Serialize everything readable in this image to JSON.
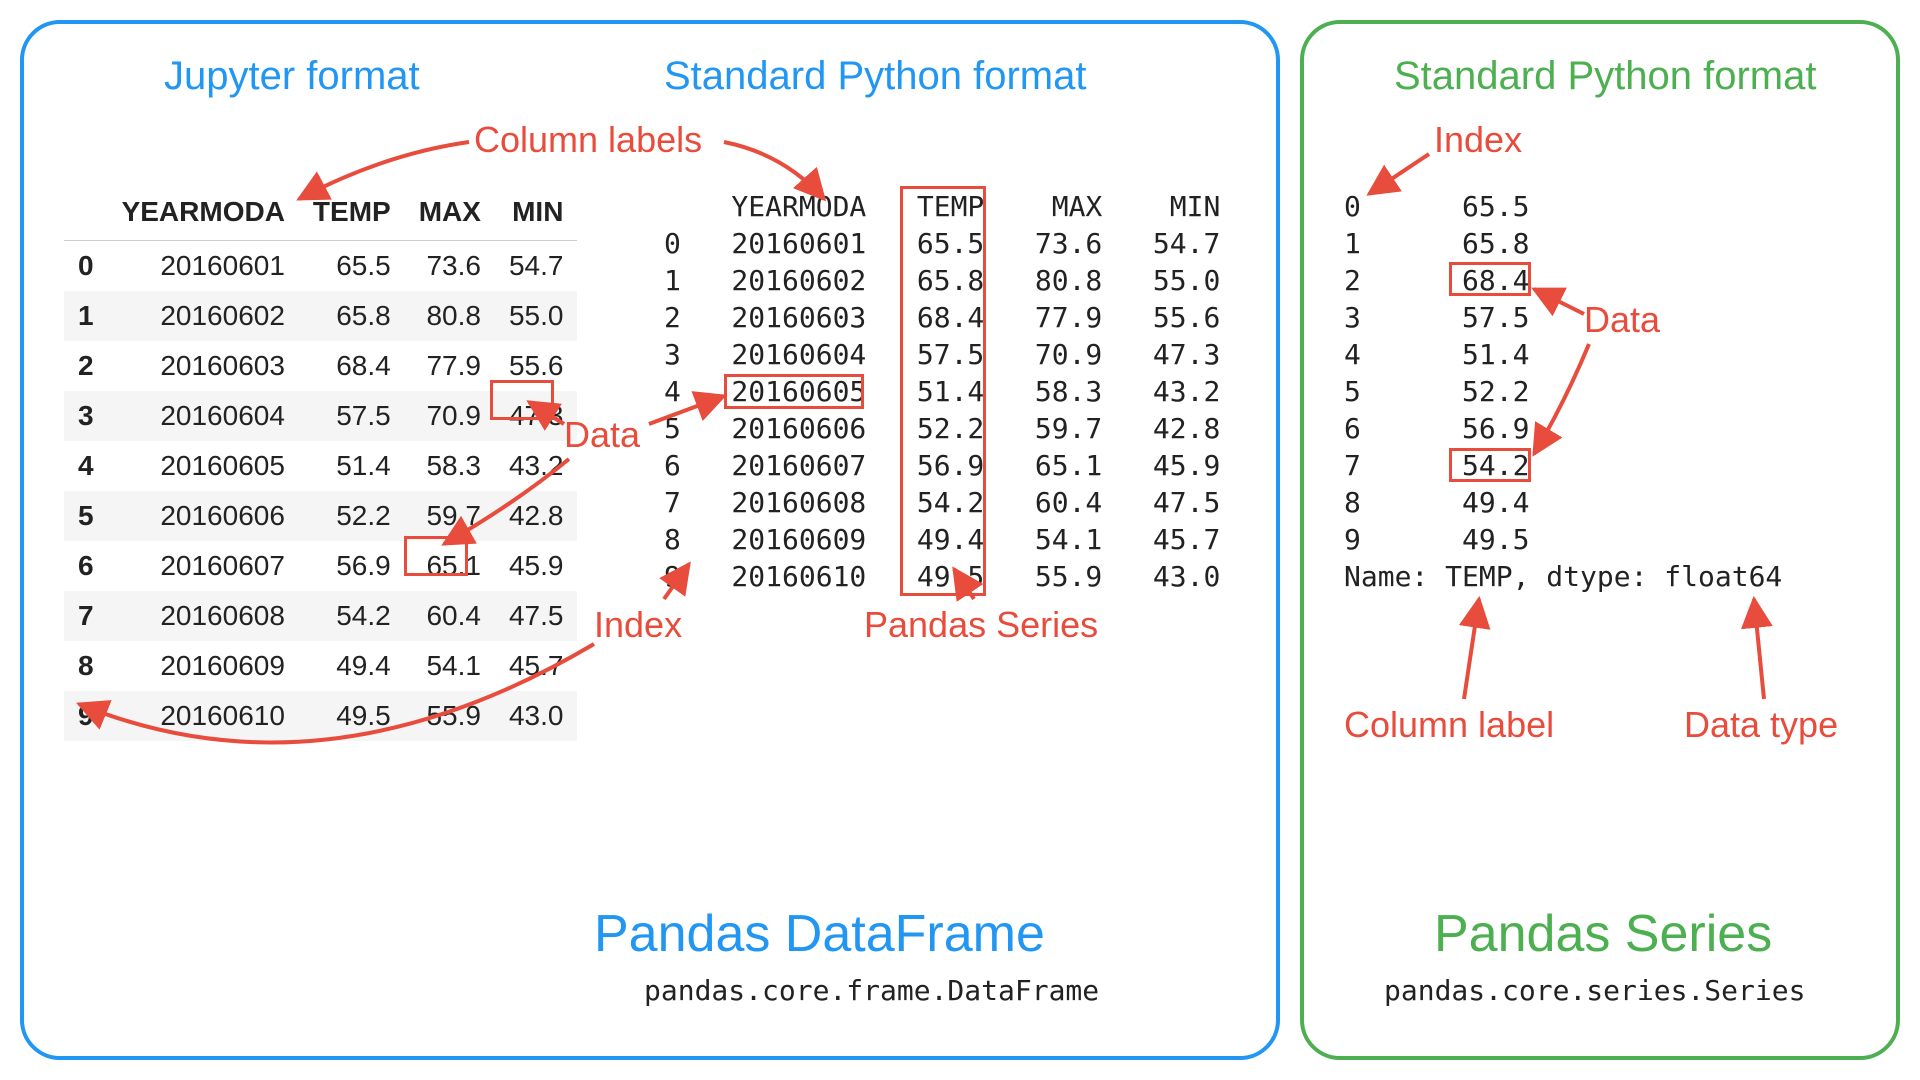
{
  "df_panel": {
    "jupyter_heading": "Jupyter format",
    "python_heading": "Standard Python format",
    "title": "Pandas DataFrame",
    "subtitle": "pandas.core.frame.DataFrame",
    "columns": [
      "YEARMODA",
      "TEMP",
      "MAX",
      "MIN"
    ],
    "rows": [
      {
        "idx": "0",
        "YEARMODA": "20160601",
        "TEMP": "65.5",
        "MAX": "73.6",
        "MIN": "54.7"
      },
      {
        "idx": "1",
        "YEARMODA": "20160602",
        "TEMP": "65.8",
        "MAX": "80.8",
        "MIN": "55.0"
      },
      {
        "idx": "2",
        "YEARMODA": "20160603",
        "TEMP": "68.4",
        "MAX": "77.9",
        "MIN": "55.6"
      },
      {
        "idx": "3",
        "YEARMODA": "20160604",
        "TEMP": "57.5",
        "MAX": "70.9",
        "MIN": "47.3"
      },
      {
        "idx": "4",
        "YEARMODA": "20160605",
        "TEMP": "51.4",
        "MAX": "58.3",
        "MIN": "43.2"
      },
      {
        "idx": "5",
        "YEARMODA": "20160606",
        "TEMP": "52.2",
        "MAX": "59.7",
        "MIN": "42.8"
      },
      {
        "idx": "6",
        "YEARMODA": "20160607",
        "TEMP": "56.9",
        "MAX": "65.1",
        "MIN": "45.9"
      },
      {
        "idx": "7",
        "YEARMODA": "20160608",
        "TEMP": "54.2",
        "MAX": "60.4",
        "MIN": "47.5"
      },
      {
        "idx": "8",
        "YEARMODA": "20160609",
        "TEMP": "49.4",
        "MAX": "54.1",
        "MIN": "45.7"
      },
      {
        "idx": "9",
        "YEARMODA": "20160610",
        "TEMP": "49.5",
        "MAX": "55.9",
        "MIN": "43.0"
      }
    ],
    "annotations": {
      "column_labels": "Column labels",
      "data": "Data",
      "index": "Index",
      "pandas_series": "Pandas Series"
    }
  },
  "series_panel": {
    "python_heading": "Standard Python format",
    "title": "Pandas Series",
    "subtitle": "pandas.core.series.Series",
    "rows": [
      {
        "idx": "0",
        "val": "65.5"
      },
      {
        "idx": "1",
        "val": "65.8"
      },
      {
        "idx": "2",
        "val": "68.4"
      },
      {
        "idx": "3",
        "val": "57.5"
      },
      {
        "idx": "4",
        "val": "51.4"
      },
      {
        "idx": "5",
        "val": "52.2"
      },
      {
        "idx": "6",
        "val": "56.9"
      },
      {
        "idx": "7",
        "val": "54.2"
      },
      {
        "idx": "8",
        "val": "49.4"
      },
      {
        "idx": "9",
        "val": "49.5"
      }
    ],
    "footer": "Name: TEMP, dtype: float64",
    "annotations": {
      "index": "Index",
      "data": "Data",
      "column_label": "Column label",
      "data_type": "Data type"
    }
  }
}
